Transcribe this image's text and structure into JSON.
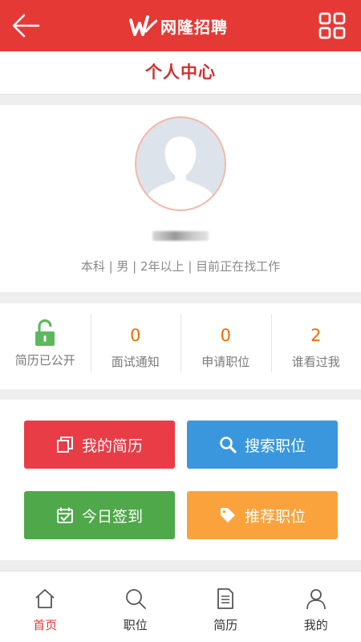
{
  "header": {
    "brand_name": "网隆招聘",
    "back_icon": "arrow-left-icon",
    "menu_icon": "grid-icon",
    "accent_color": "#e53935"
  },
  "page": {
    "title": "个人中心"
  },
  "profile": {
    "info": "本科 | 男 | 2年以上 | 目前正在找工作"
  },
  "stats": [
    {
      "icon": "unlock-icon",
      "label": "简历已公开"
    },
    {
      "value": "0",
      "label": "面试通知"
    },
    {
      "value": "0",
      "label": "申请职位"
    },
    {
      "value": "2",
      "label": "谁看过我"
    }
  ],
  "actions": {
    "my_resume": {
      "label": "我的简历",
      "icon": "copy-icon",
      "color": "#e83d46"
    },
    "search_jobs": {
      "label": "搜索职位",
      "icon": "search-icon",
      "color": "#3a97dd"
    },
    "daily_checkin": {
      "label": "今日签到",
      "icon": "calendar-check-icon",
      "color": "#4fa84a"
    },
    "recommended_jobs": {
      "label": "推荐职位",
      "icon": "tag-icon",
      "color": "#faa33c"
    }
  },
  "tabs": [
    {
      "label": "首页",
      "icon": "home-icon",
      "active": true
    },
    {
      "label": "职位",
      "icon": "search-icon"
    },
    {
      "label": "简历",
      "icon": "document-icon"
    },
    {
      "label": "我的",
      "icon": "person-icon"
    }
  ]
}
